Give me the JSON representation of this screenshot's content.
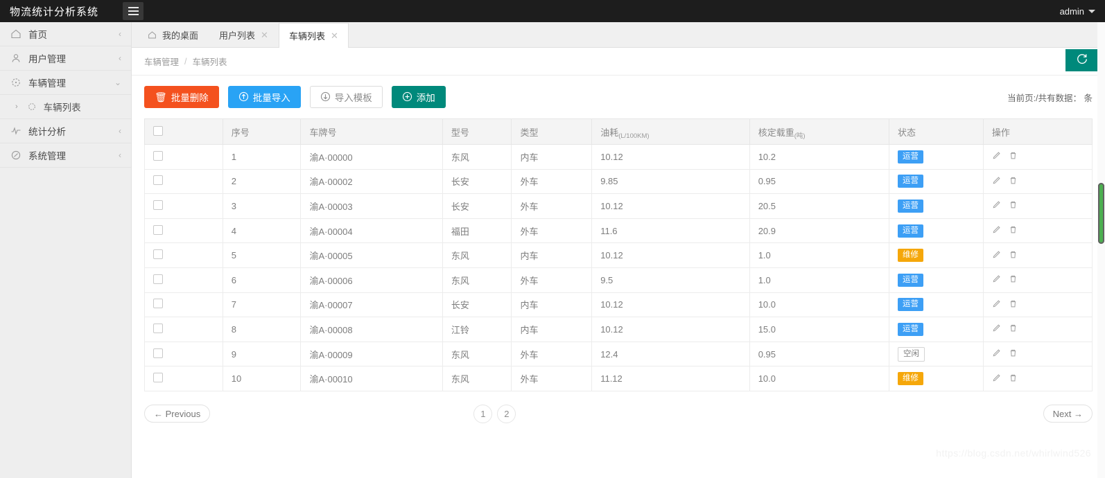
{
  "app": {
    "brand": "物流统计分析系统",
    "menu_icon": "hamburger-icon",
    "user": "admin"
  },
  "sidebar": {
    "items": [
      {
        "label": "首页",
        "icon": "home-icon",
        "arrow": "‹",
        "expanded": false
      },
      {
        "label": "用户管理",
        "icon": "user-icon",
        "arrow": "‹",
        "expanded": false
      },
      {
        "label": "车辆管理",
        "icon": "truck-icon",
        "arrow": "⌄",
        "expanded": true
      },
      {
        "label": "统计分析",
        "icon": "chart-icon",
        "arrow": "‹",
        "expanded": false
      },
      {
        "label": "系统管理",
        "icon": "gear-icon",
        "arrow": "‹",
        "expanded": false
      }
    ],
    "submenu": {
      "label": "车辆列表",
      "arrow": "›",
      "icon": "circle-icon"
    }
  },
  "tabs": [
    {
      "label": "我的桌面",
      "icon": "home-icon",
      "closable": false,
      "active": false
    },
    {
      "label": "用户列表",
      "closable": true,
      "active": false
    },
    {
      "label": "车辆列表",
      "closable": true,
      "active": true
    }
  ],
  "breadcrumb": {
    "parent": "车辆管理",
    "sep": "/",
    "current": "车辆列表"
  },
  "refresh": {
    "icon": "refresh-icon",
    "color": "#00897b"
  },
  "toolbar": {
    "batch_delete": "批量删除",
    "batch_delete_icon": "trash-icon",
    "batch_import": "批量导入",
    "batch_import_icon": "upload-circle-icon",
    "import_template": "导入模板",
    "import_template_icon": "download-circle-icon",
    "add": "添加",
    "add_icon": "plus-circle-icon",
    "count_info": "当前页:/共有数据： 条"
  },
  "table": {
    "columns": [
      {
        "key": "checkbox",
        "label": ""
      },
      {
        "key": "index",
        "label": "序号"
      },
      {
        "key": "plate",
        "label": "车牌号"
      },
      {
        "key": "model",
        "label": "型号"
      },
      {
        "key": "type",
        "label": "类型"
      },
      {
        "key": "fuel",
        "label": "油耗",
        "unit": "(L/100KM)"
      },
      {
        "key": "load",
        "label": "核定载重",
        "unit": "(吨)"
      },
      {
        "key": "status",
        "label": "状态"
      },
      {
        "key": "actions",
        "label": "操作"
      }
    ],
    "rows": [
      {
        "index": "1",
        "plate": "渝A·00000",
        "model": "东风",
        "type": "内车",
        "fuel": "10.12",
        "load": "10.2",
        "status": "运营",
        "status_style": "primary"
      },
      {
        "index": "2",
        "plate": "渝A·00002",
        "model": "长安",
        "type": "外车",
        "fuel": "9.85",
        "load": "0.95",
        "status": "运营",
        "status_style": "primary"
      },
      {
        "index": "3",
        "plate": "渝A·00003",
        "model": "长安",
        "type": "外车",
        "fuel": "10.12",
        "load": "20.5",
        "status": "运营",
        "status_style": "primary"
      },
      {
        "index": "4",
        "plate": "渝A·00004",
        "model": "福田",
        "type": "外车",
        "fuel": "11.6",
        "load": "20.9",
        "status": "运营",
        "status_style": "primary"
      },
      {
        "index": "5",
        "plate": "渝A·00005",
        "model": "东风",
        "type": "内车",
        "fuel": "10.12",
        "load": "1.0",
        "status": "维修",
        "status_style": "warning"
      },
      {
        "index": "6",
        "plate": "渝A·00006",
        "model": "东风",
        "type": "外车",
        "fuel": "9.5",
        "load": "1.0",
        "status": "运营",
        "status_style": "primary"
      },
      {
        "index": "7",
        "plate": "渝A·00007",
        "model": "长安",
        "type": "内车",
        "fuel": "10.12",
        "load": "10.0",
        "status": "运营",
        "status_style": "primary"
      },
      {
        "index": "8",
        "plate": "渝A·00008",
        "model": "江铃",
        "type": "内车",
        "fuel": "10.12",
        "load": "15.0",
        "status": "运营",
        "status_style": "primary"
      },
      {
        "index": "9",
        "plate": "渝A·00009",
        "model": "东风",
        "type": "外车",
        "fuel": "12.4",
        "load": "0.95",
        "status": "空闲",
        "status_style": "default"
      },
      {
        "index": "10",
        "plate": "渝A·00010",
        "model": "东风",
        "type": "外车",
        "fuel": "11.12",
        "load": "10.0",
        "status": "维修",
        "status_style": "warning"
      }
    ],
    "row_actions": [
      {
        "icon": "edit-pencil-icon"
      },
      {
        "icon": "trash-icon"
      }
    ]
  },
  "pagination": {
    "previous": "← Previous",
    "next": "Next →",
    "pages": [
      "1",
      "2"
    ],
    "current": "1"
  },
  "watermark": "https://blog.csdn.net/whirlwind526",
  "colors": {
    "topbar": "#1d1d1d",
    "sidebar": "#eeeeee",
    "danger": "#f4511e",
    "primary": "#29a3f5",
    "success": "#00897b",
    "warning": "#f5a70a",
    "badge_primary": "#3d9ff5"
  }
}
